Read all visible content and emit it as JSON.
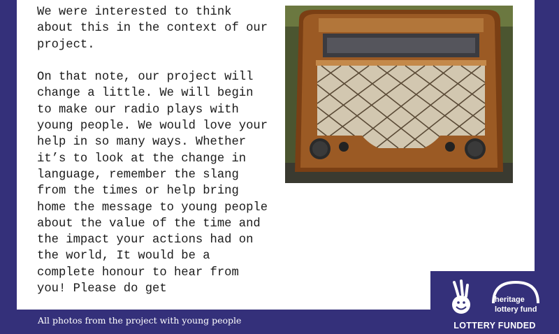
{
  "content": {
    "paragraph1": "We were interested to think about this in the context of our project.",
    "paragraph2": "On that note, our project will change a little. We will begin to make our radio plays with young people. We would love your help in so many ways. Whether it’s to look at the change in language, remember the slang from the times or help bring home the message to young people about the value of the time and the impact your actions had on the world, It would be a complete honour to hear from you! Please do get"
  },
  "footer": {
    "caption": "All photos from the project with young people"
  },
  "funding": {
    "logo_text_line1": "heritage",
    "logo_text_line2": "lottery fund",
    "funded_label": "LOTTERY FUNDED"
  },
  "colors": {
    "brand_purple": "#34307a",
    "card_white": "#ffffff"
  }
}
